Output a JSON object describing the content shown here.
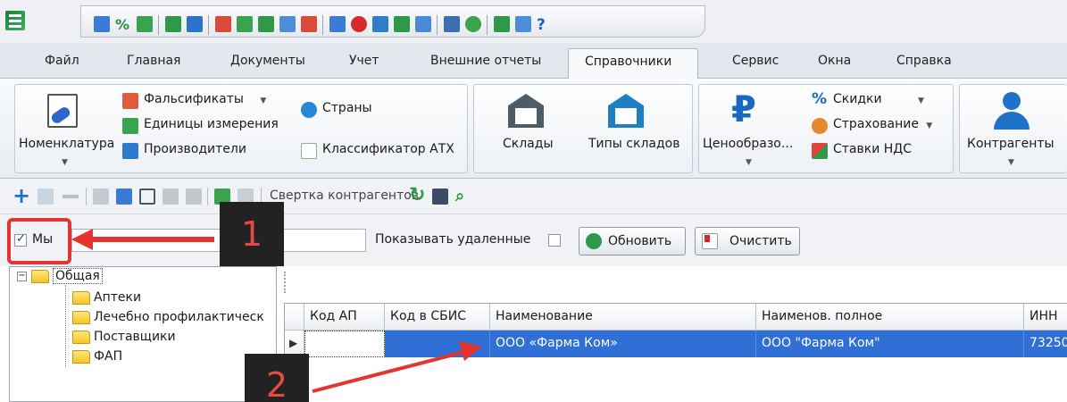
{
  "menu": {
    "tabs": [
      "Файл",
      "Главная",
      "Документы",
      "Учет",
      "Внешние отчеты",
      "Справочники",
      "Сервис",
      "Окна",
      "Справка"
    ],
    "active": "Справочники"
  },
  "ribbon": {
    "nomenclature": "Номенклатура",
    "falsifications": "Фальсификаты",
    "units": "Единицы измерения",
    "manufacturers": "Производители",
    "countries": "Страны",
    "atc": "Классификатор АТХ",
    "warehouses": "Склады",
    "warehouse_types": "Типы складов",
    "pricing": "Ценообразо...",
    "discounts": "Скидки",
    "insurance": "Страхование",
    "vat": "Ставки НДС",
    "contractors": "Контрагенты"
  },
  "toolbar": {
    "merge_label": "Свертка контрагентов"
  },
  "filter": {
    "we_label": "Мы",
    "we_checked": true,
    "search_value": "",
    "show_deleted_label": "Показывать удаленные",
    "show_deleted_checked": false,
    "refresh_label": "Обновить",
    "clear_label": "Очистить"
  },
  "tree": {
    "root": "Общая",
    "children": [
      "Аптеки",
      "Лечебно профилактическ",
      "Поставщики",
      "ФАП"
    ]
  },
  "grid": {
    "columns": [
      "Код АП",
      "Код в СБИС",
      "Наименование",
      "Наименов. полное",
      "ИНН"
    ],
    "rows": [
      [
        "",
        "",
        "ООО «Фарма Ком»",
        "ООО \"Фарма Ком\"",
        "73250"
      ]
    ]
  },
  "annotations": {
    "step1": "1",
    "step2": "2"
  },
  "colors": {
    "selection": "#2f6fd6",
    "annotation": "#e3342f"
  }
}
